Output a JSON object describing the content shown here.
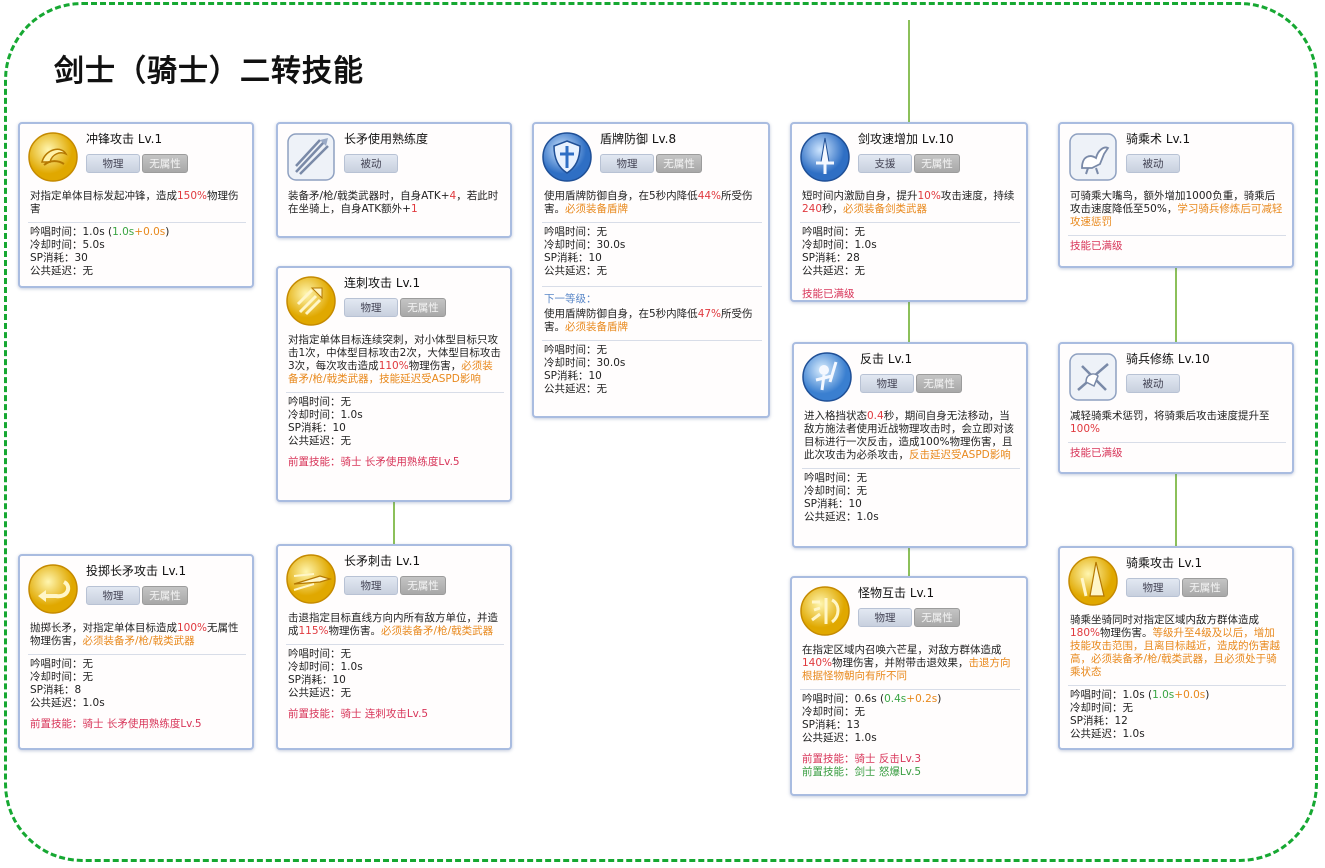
{
  "page": {
    "title": "剑士（骑士）二转技能"
  },
  "colors": {
    "border_dashed": "#16a832",
    "card_border": "#a9bce0",
    "red": "#e0393e",
    "orange": "#e8891d",
    "green": "#3aa543",
    "prereq": "#d8365a"
  },
  "tags": {
    "physical": "物理",
    "no_element": "无属性",
    "passive": "被动",
    "support": "支援"
  },
  "cards": {
    "charge": {
      "name": "冲锋攻击 Lv.1",
      "icon": "charge-icon",
      "desc_a": "对指定单体目标发起冲锋，造成",
      "desc_b": "150%",
      "desc_c": "物理伤害",
      "cast_a": "吟唱时间：1.0s (",
      "cast_b": "1.0s",
      "cast_c": "+",
      "cast_d": "0.0s",
      "cast_e": ")",
      "cooldown": "冷却时间：5.0s",
      "sp": "SP消耗：30",
      "delay": "公共延迟：无"
    },
    "spear_mastery": {
      "name": "长矛使用熟练度",
      "icon": "spear-mastery-icon",
      "desc_a": "装备矛/枪/戟类武器时，自身ATK+",
      "desc_b": "4",
      "desc_c": "，若此时在坐骑上，自身ATK额外+",
      "desc_d": "1"
    },
    "pierce": {
      "name": "连刺攻击 Lv.1",
      "icon": "pierce-icon",
      "desc_a": "对指定单体目标连续突刺，对小体型目标只攻击1次，中体型目标攻击2次，大体型目标攻击3次，每次攻击造成",
      "desc_b": "110%",
      "desc_c": "物理伤害，",
      "desc_d": "必须装备矛/枪/戟类武器，技能延迟受ASPD影响",
      "cast": "吟唱时间：无",
      "cooldown": "冷却时间：1.0s",
      "sp": "SP消耗：10",
      "delay": "公共延迟：无",
      "prereq": "前置技能：骑士 长矛使用熟练度Lv.5"
    },
    "spear_stab": {
      "name": "长矛刺击 Lv.1",
      "icon": "spear-stab-icon",
      "desc_a": "击退指定目标直线方向内所有敌方单位，并造成",
      "desc_b": "115%",
      "desc_c": "物理伤害。",
      "desc_d": "必须装备矛/枪/戟类武器",
      "cast": "吟唱时间：无",
      "cooldown": "冷却时间：1.0s",
      "sp": "SP消耗：10",
      "delay": "公共延迟：无",
      "prereq": "前置技能：骑士 连刺攻击Lv.5"
    },
    "spear_throw": {
      "name": "投掷长矛攻击 Lv.1",
      "icon": "spear-throw-icon",
      "desc_a": "抛掷长矛，对指定单体目标造成",
      "desc_b": "100%",
      "desc_c": "无属性物理伤害，",
      "desc_d": "必须装备矛/枪/戟类武器",
      "cast": "吟唱时间：无",
      "cooldown": "冷却时间：无",
      "sp": "SP消耗：8",
      "delay": "公共延迟：1.0s",
      "prereq": "前置技能：骑士 长矛使用熟练度Lv.5"
    },
    "shield": {
      "name": "盾牌防御 Lv.8",
      "icon": "shield-icon",
      "desc_a": "使用盾牌防御自身，在5秒内降低",
      "desc_b": "44%",
      "desc_c": "所受伤害。",
      "desc_d": "必须装备盾牌",
      "cast": "吟唱时间：无",
      "cooldown": "冷却时间：30.0s",
      "sp": "SP消耗：10",
      "delay": "公共延迟：无",
      "next_label": "下一等级：",
      "next_a": "使用盾牌防御自身，在5秒内降低",
      "next_b": "47%",
      "next_c": "所受伤害。",
      "next_d": "必须装备盾牌",
      "next_cast": "吟唱时间：无",
      "next_cooldown": "冷却时间：30.0s",
      "next_sp": "SP消耗：10",
      "next_delay": "公共延迟：无"
    },
    "sword_quicken": {
      "name": "剑攻速增加 Lv.10",
      "icon": "sword-quicken-icon",
      "desc_a": "短时间内激励自身，提升",
      "desc_b": "10%",
      "desc_c": "攻击速度，持续",
      "desc_d": "240",
      "desc_e": "秒，",
      "desc_f": "必须装备剑类武器",
      "cast": "吟唱时间：无",
      "cooldown": "冷却时间：1.0s",
      "sp": "SP消耗：28",
      "delay": "公共延迟：无",
      "maxed": "技能已满级"
    },
    "counter": {
      "name": "反击 Lv.1",
      "icon": "counter-icon",
      "desc_a": "进入格挡状态",
      "desc_b": "0.4",
      "desc_c": "秒，期间自身无法移动，当敌方施法者使用近战物理攻击时，会立即对该目标进行一次反击，造成100%物理伤害，且此次攻击为必杀攻击，",
      "desc_d": "反击延迟受ASPD影响",
      "cast": "吟唱时间：无",
      "cooldown": "冷却时间：无",
      "sp": "SP消耗：10",
      "delay": "公共延迟：1.0s"
    },
    "brandish": {
      "name": "怪物互击 Lv.1",
      "icon": "brandish-icon",
      "desc_a": "在指定区域内召唤六芒星，对敌方群体造成",
      "desc_b": "140%",
      "desc_c": "物理伤害，并附带击退效果，",
      "desc_d": "击退方向根据怪物朝向有所不同",
      "cast_a": "吟唱时间：0.6s (",
      "cast_b": "0.4s",
      "cast_c": "+",
      "cast_d": "0.2s",
      "cast_e": ")",
      "cooldown": "冷却时间：无",
      "sp": "SP消耗：13",
      "delay": "公共延迟：1.0s",
      "prereq": "前置技能：骑士 反击Lv.3",
      "prereq2": "前置技能：剑士 怒爆Lv.5"
    },
    "riding": {
      "name": "骑乘术 Lv.1",
      "icon": "riding-icon",
      "desc_a": "可骑乘大嘴鸟，额外增加1000负重，骑乘后攻击速度降低至50%，",
      "desc_b": "学习骑兵修炼后可减轻攻速惩罚",
      "maxed": "技能已满级"
    },
    "cavalier": {
      "name": "骑兵修练 Lv.10",
      "icon": "cavalier-icon",
      "desc_a": "减轻骑乘术惩罚，将骑乘后攻击速度提升至",
      "desc_b": "100%",
      "maxed": "技能已满级"
    },
    "riding_attack": {
      "name": "骑乘攻击 Lv.1",
      "icon": "riding-attack-icon",
      "desc_a": "骑乘坐骑同时对指定区域内敌方群体造成",
      "desc_b": "180%",
      "desc_c": "物理伤害。",
      "desc_d": "等级升至4级及以后，增加技能攻击范围，且离目标越近，造成的伤害越高，必须装备矛/枪/戟类武器，且必须处于骑乘状态",
      "cast_a": "吟唱时间：1.0s (",
      "cast_b": "1.0s",
      "cast_c": "+",
      "cast_d": "0.0s",
      "cast_e": ")",
      "cooldown": "冷却时间：无",
      "sp": "SP消耗：12",
      "delay": "公共延迟：1.0s"
    }
  }
}
